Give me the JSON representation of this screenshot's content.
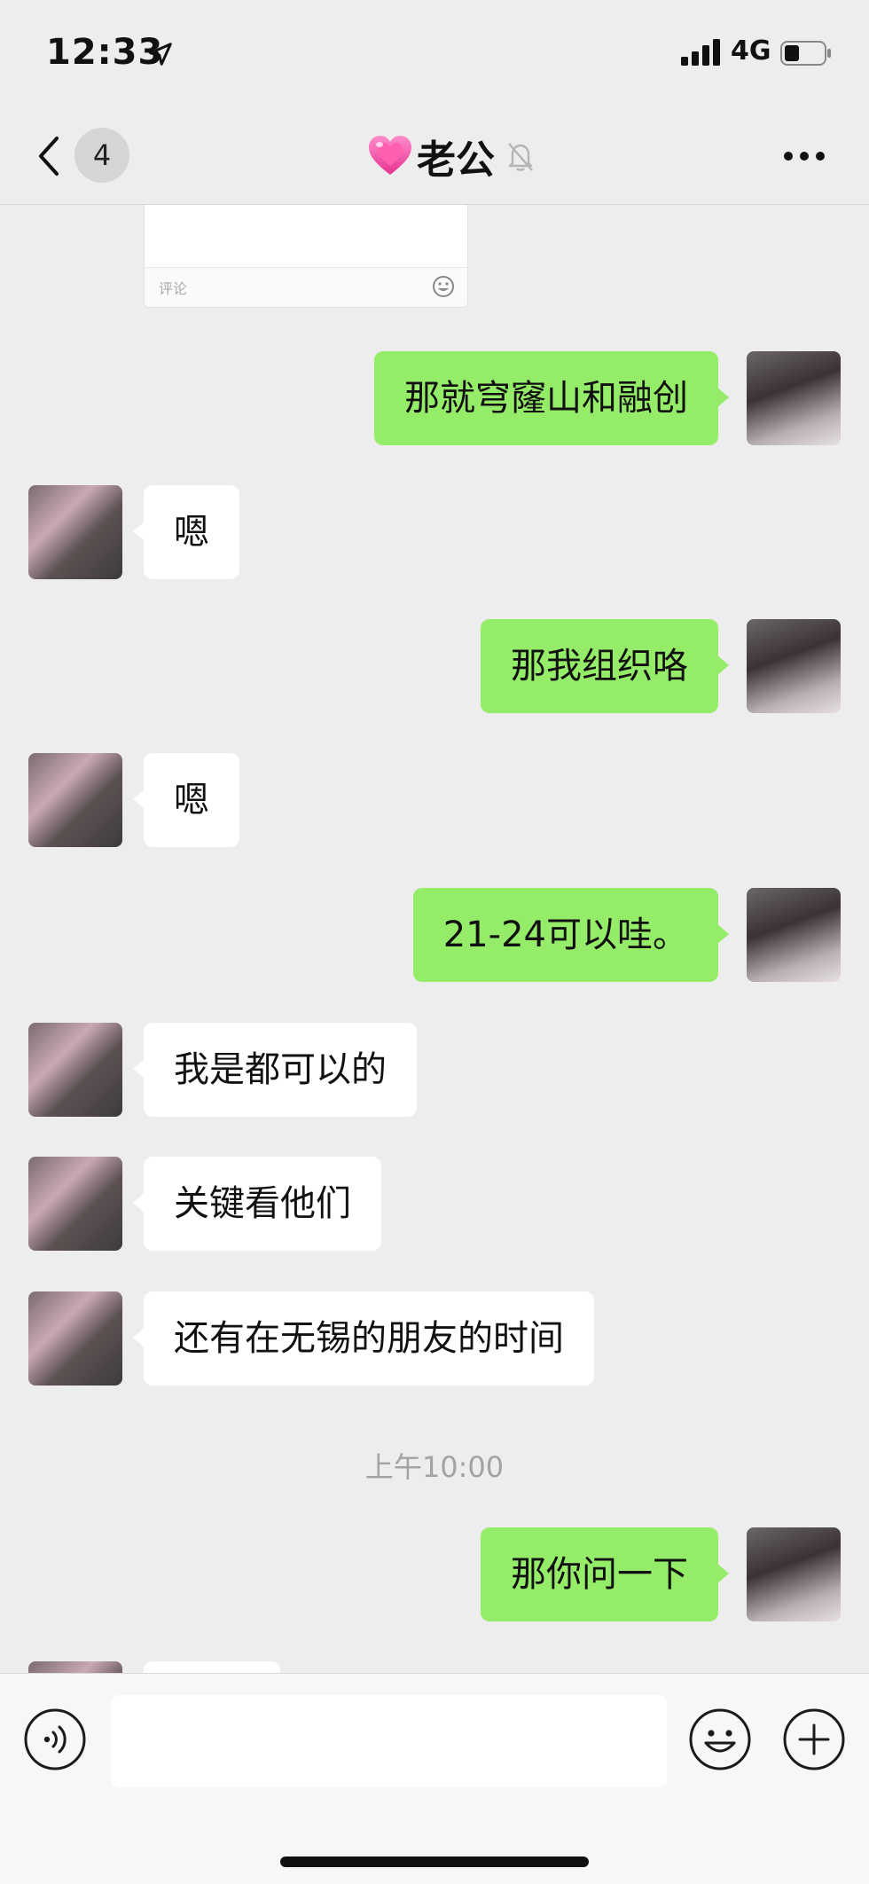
{
  "status_bar": {
    "time": "12:33",
    "network": "4G"
  },
  "nav": {
    "unread_count": "4",
    "title": "老公"
  },
  "moments_card": {
    "comment_placeholder": "评论"
  },
  "messages": [
    {
      "side": "out",
      "text": "那就穹窿山和融创"
    },
    {
      "side": "in",
      "text": "嗯"
    },
    {
      "side": "out",
      "text": "那我组织咯"
    },
    {
      "side": "in",
      "text": "嗯"
    },
    {
      "side": "out",
      "text": "21-24可以哇。"
    },
    {
      "side": "in",
      "text": "我是都可以的"
    },
    {
      "side": "in",
      "text": "关键看他们"
    },
    {
      "side": "in",
      "text": "还有在无锡的朋友的时间"
    },
    {
      "side": "out",
      "text": "那你问一下"
    }
  ],
  "timestamp": "上午10:00",
  "colors": {
    "outgoing_bubble": "#95ec69",
    "incoming_bubble": "#ffffff",
    "background": "#ededed"
  }
}
